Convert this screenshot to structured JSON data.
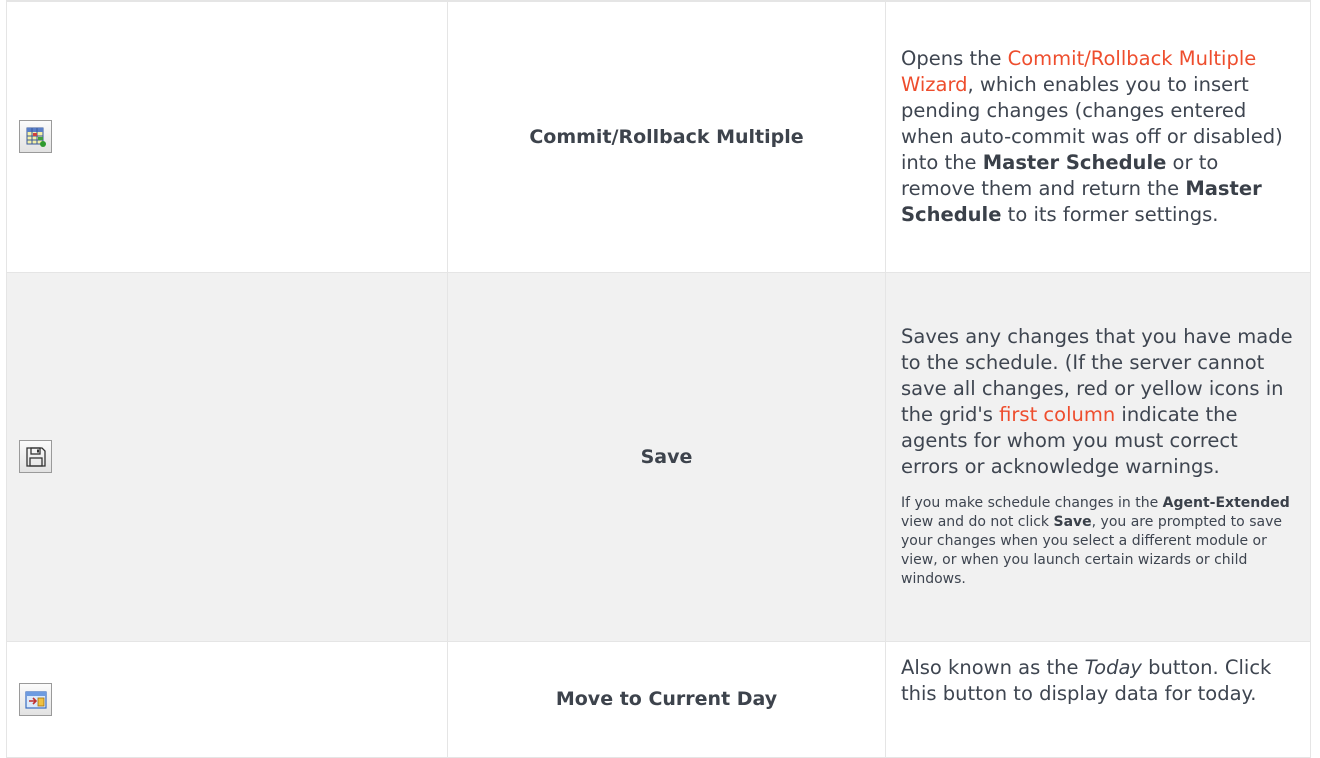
{
  "rows": [
    {
      "icon": "commit-rollback-multiple-icon",
      "name": "Commit/Rollback Multiple",
      "description": {
        "t1": "Opens the ",
        "link": "Commit/Rollback Multiple Wizard",
        "t2": ", which enables you to insert pending changes (changes entered when auto-commit was off or disabled) into the ",
        "b1": "Master Schedule",
        "t3": " or to remove them and return the ",
        "b2": "Master Schedule",
        "t4": " to its former settings."
      }
    },
    {
      "icon": "save-icon",
      "name": "Save",
      "description": {
        "t1": "Saves any changes that you have made to the schedule. (If the server cannot save all changes, red or yellow icons in the grid's ",
        "link": "first column",
        "t2": " indicate the agents for whom you must correct errors or acknowledge warnings."
      },
      "note": {
        "t1": "If you make schedule changes in the ",
        "b1": "Agent-Extended",
        "t2": " view and do not click ",
        "b2": "Save",
        "t3": ", you are prompted to save your changes when you select a different module or view, or when you launch certain wizards or child windows."
      }
    },
    {
      "icon": "move-to-current-day-icon",
      "name": "Move to Current Day",
      "description": {
        "t1": "Also known as the ",
        "i1": "Today",
        "t2": " button. Click this button to display data for today."
      }
    }
  ],
  "colors": {
    "link": "#ee4d2d",
    "text": "#404853",
    "shaded_row": "#f1f1f1",
    "border": "#e5e5e5"
  }
}
